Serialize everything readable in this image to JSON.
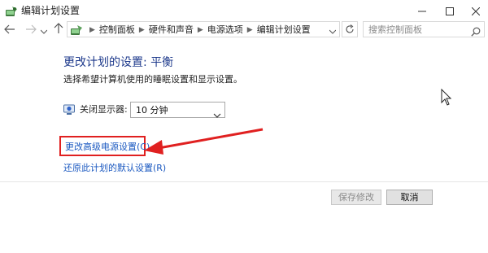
{
  "window": {
    "title": "编辑计划设置",
    "icons": [
      "power-options-icon",
      "minimize-icon",
      "maximize-icon",
      "close-icon"
    ]
  },
  "address_bar": {
    "breadcrumbs": [
      "控制面板",
      "硬件和声音",
      "电源选项",
      "编辑计划设置"
    ],
    "search_placeholder": "搜索控制面板",
    "icons": [
      "back-arrow-icon",
      "forward-arrow-icon",
      "chevron-down-icon",
      "up-arrow-icon",
      "refresh-icon",
      "search-icon"
    ]
  },
  "main": {
    "heading": "更改计划的设置: 平衡",
    "subheading": "选择希望计算机使用的睡眠设置和显示设置。",
    "display_off": {
      "label": "关闭显示器:",
      "value": "10 分钟",
      "icon": "monitor-power-icon"
    },
    "links": {
      "advanced": "更改高级电源设置(C)",
      "restore_defaults": "还原此计划的默认设置(R)"
    },
    "annotation_color": "#e02020",
    "link_color": "#1a58c0"
  },
  "footer": {
    "save_label": "保存修改",
    "cancel_label": "取消"
  }
}
